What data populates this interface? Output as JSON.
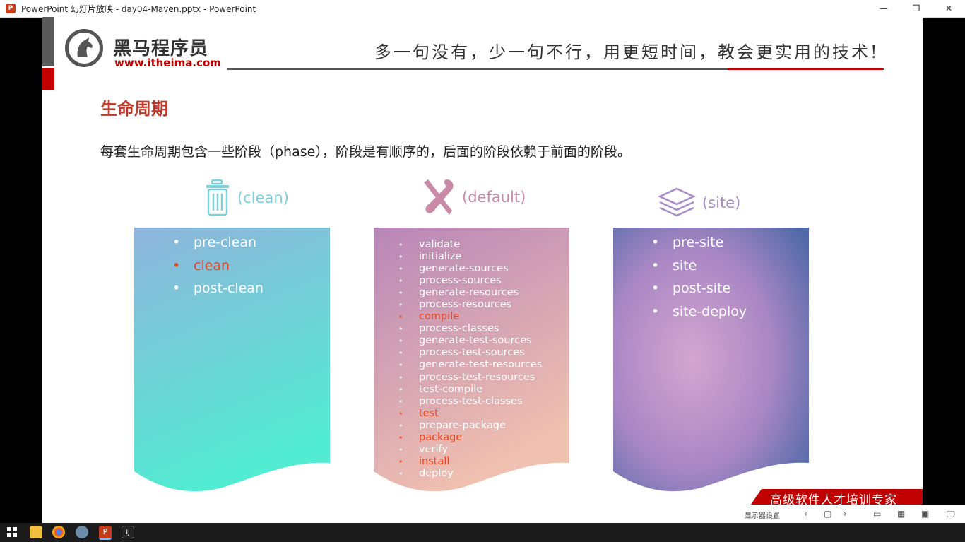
{
  "window": {
    "title": "PowerPoint 幻灯片放映  -  day04-Maven.pptx - PowerPoint",
    "minimize": "—",
    "restore": "❐",
    "close": "✕"
  },
  "logo": {
    "name": "黑马程序员",
    "url": "www.itheima.com"
  },
  "slogan": "多一句没有，少一句不行，用更短时间，教会更实用的技术!",
  "heading": "生命周期",
  "description": "每套生命周期包含一些阶段（phase），阶段是有顺序的，后面的阶段依赖于前面的阶段。",
  "lifecycles": [
    {
      "label": "(clean)",
      "icon": "trash-icon",
      "color": "#7fd0d8",
      "phases": [
        {
          "name": "pre-clean",
          "highlight": false
        },
        {
          "name": "clean",
          "highlight": true
        },
        {
          "name": "post-clean",
          "highlight": false
        }
      ]
    },
    {
      "label": "(default)",
      "icon": "tools-icon",
      "color": "#c98aa8",
      "phases": [
        {
          "name": "validate",
          "highlight": false
        },
        {
          "name": "initialize",
          "highlight": false
        },
        {
          "name": "generate-sources",
          "highlight": false
        },
        {
          "name": "process-sources",
          "highlight": false
        },
        {
          "name": "generate-resources",
          "highlight": false
        },
        {
          "name": "process-resources",
          "highlight": false
        },
        {
          "name": "compile",
          "highlight": true
        },
        {
          "name": "process-classes",
          "highlight": false
        },
        {
          "name": "generate-test-sources",
          "highlight": false
        },
        {
          "name": "process-test-sources",
          "highlight": false
        },
        {
          "name": "generate-test-resources",
          "highlight": false
        },
        {
          "name": "process-test-resources",
          "highlight": false
        },
        {
          "name": "test-compile",
          "highlight": false
        },
        {
          "name": "process-test-classes",
          "highlight": false
        },
        {
          "name": "test",
          "highlight": true
        },
        {
          "name": "prepare-package",
          "highlight": false
        },
        {
          "name": "package",
          "highlight": true
        },
        {
          "name": "verify",
          "highlight": false
        },
        {
          "name": "install",
          "highlight": true
        },
        {
          "name": "deploy",
          "highlight": false
        }
      ]
    },
    {
      "label": "(site)",
      "icon": "layers-icon",
      "color": "#a78bc8",
      "phases": [
        {
          "name": "pre-site",
          "highlight": false
        },
        {
          "name": "site",
          "highlight": false
        },
        {
          "name": "post-site",
          "highlight": false
        },
        {
          "name": "site-deploy",
          "highlight": false
        }
      ]
    }
  ],
  "banner": "高级软件人才培训专家",
  "slideshow_toolbar": {
    "display_settings": "显示器设置"
  },
  "colors": {
    "accent_red": "#c00000",
    "highlight_phase": "#e8451e"
  }
}
